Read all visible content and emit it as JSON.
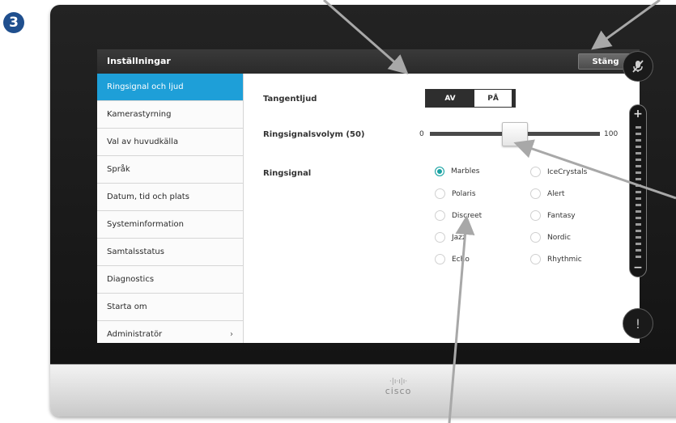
{
  "step_badge": "3",
  "window": {
    "title": "Inställningar",
    "close_label": "Stäng"
  },
  "sidebar": {
    "items": [
      {
        "label": "Ringsignal och ljud",
        "active": true
      },
      {
        "label": "Kamerastyrning"
      },
      {
        "label": "Val av huvudkälla"
      },
      {
        "label": "Språk"
      },
      {
        "label": "Datum, tid och plats"
      },
      {
        "label": "Systeminformation"
      },
      {
        "label": "Samtalsstatus"
      },
      {
        "label": "Diagnostics"
      },
      {
        "label": "Starta om"
      },
      {
        "label": "Administratör",
        "has_submenu": true
      }
    ],
    "active_color": "#1e9fd8"
  },
  "keytones": {
    "label": "Tangentljud",
    "off_label": "AV",
    "on_label": "PÅ",
    "selected": "AV"
  },
  "ringtone_volume": {
    "label": "Ringsignalsvolym (50)",
    "min_label": "0",
    "max_label": "100",
    "value": 50
  },
  "ringtone": {
    "label": "Ringsignal",
    "selected": "Marbles",
    "options_col1": [
      "Marbles",
      "Polaris",
      "Discreet",
      "Jazz",
      "Echo"
    ],
    "options_col2": [
      "IceCrystals",
      "Alert",
      "Fantasy",
      "Nordic",
      "Rhythmic"
    ],
    "selected_color": "#1aa3a3"
  },
  "hardware": {
    "brand": "cisco",
    "volume_plus": "+",
    "volume_minus": "−",
    "alert_symbol": "!",
    "mute_icon": "microphone-muted-icon"
  },
  "annotation_color": "#a8a8a8"
}
